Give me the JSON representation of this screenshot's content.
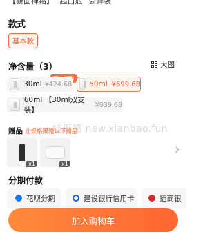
{
  "top_cut_text": "【新面禅霜】 \"超白瓶\" 会鲜装",
  "style_section": {
    "title": "款式",
    "selected_option": "基本款"
  },
  "capacity_section": {
    "title": "净含量（3）",
    "view_toggle": "大图",
    "hot_tag": "万人加购",
    "options": [
      {
        "name": "30ml",
        "price": "¥424.68",
        "selected": false
      },
      {
        "name": "50ml",
        "price": "¥699.68",
        "selected": true
      },
      {
        "name": "60ml 【30ml双支装】",
        "price": "¥939.68",
        "selected": false
      }
    ]
  },
  "gift_section": {
    "title": "赠品",
    "subtitle": "此规格限赠以下赠品",
    "items": [
      {
        "qty": "x1"
      },
      {
        "qty": "x1"
      }
    ]
  },
  "watermark": "线报酷 new.xianbao.fun",
  "installment_section": {
    "title": "分期付款",
    "options": [
      {
        "label": "花呗分期"
      },
      {
        "label": "建设银行信用卡"
      },
      {
        "label": "招商银"
      }
    ]
  },
  "cart_button_label": "加入购物车",
  "colors": {
    "accent": "#ff5a2a",
    "button_start": "#ff8a3d",
    "button_end": "#ff6630"
  }
}
